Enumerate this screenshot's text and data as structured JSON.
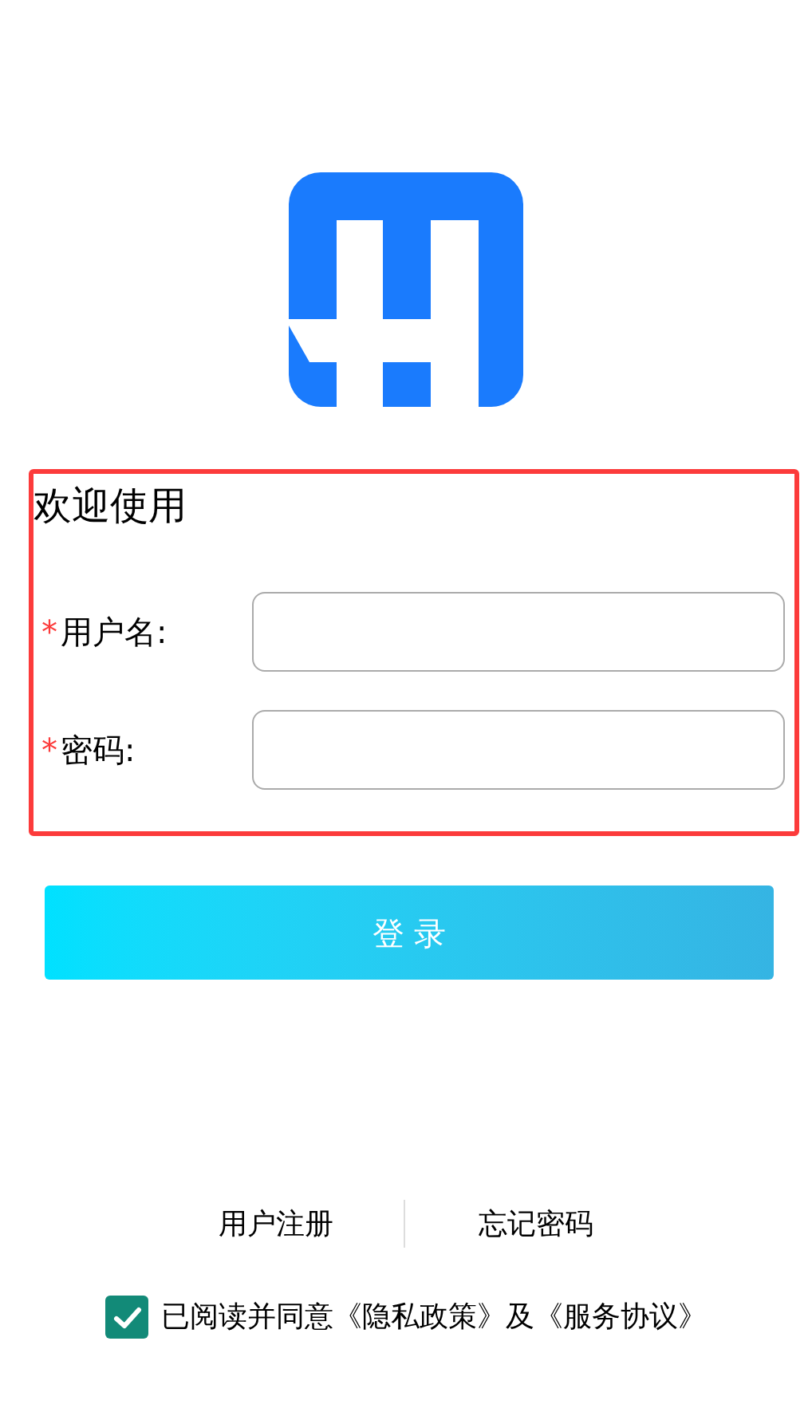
{
  "form": {
    "title": "欢迎使用",
    "fields": [
      {
        "required": true,
        "required_mark": "*",
        "label": "用户名:"
      },
      {
        "required": true,
        "required_mark": "*",
        "label": "密码:"
      }
    ]
  },
  "login_button": "登 录",
  "links": [
    "用户注册",
    "忘记密码"
  ],
  "agreement": {
    "checked": true,
    "text": "已阅读并同意《隐私政策》及《服务协议》"
  }
}
